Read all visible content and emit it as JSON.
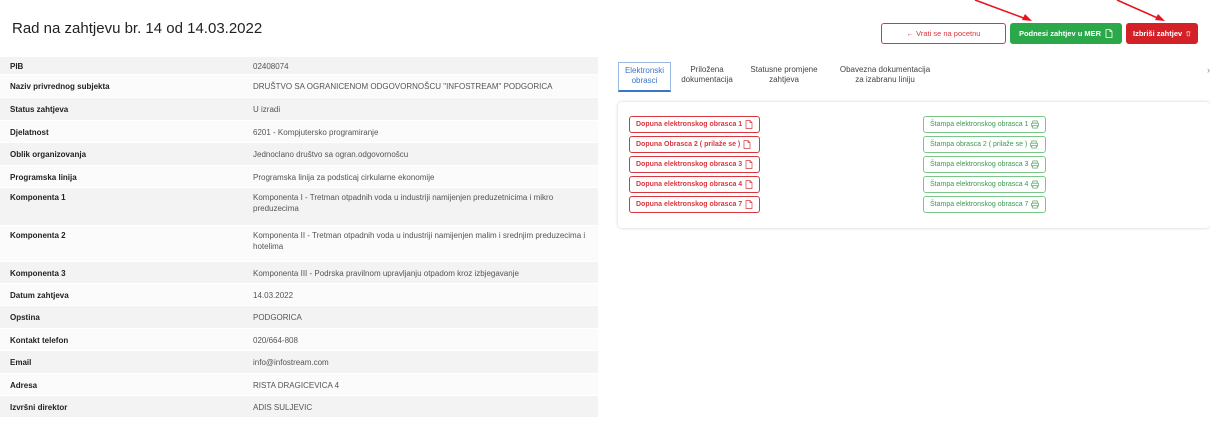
{
  "page_title": "Rad na zahtjevu br. 14 od 14.03.2022",
  "actions": {
    "back_label": "← Vrati se na pocetnu",
    "submit_label": "Podnesi zahtjev u MER",
    "delete_label": "Izbriši zahtjev"
  },
  "details": [
    {
      "label": "PIB",
      "value": "02408074"
    },
    {
      "label": "Naziv privrednog subjekta",
      "value": "DRUŠTVO SA OGRANICENOM ODGOVORNOŠCU \"INFOSTREAM\" PODGORICA"
    },
    {
      "label": "Status zahtjeva",
      "value": "U izradi"
    },
    {
      "label": "Djelatnost",
      "value": "6201 - Kompjutersko programiranje"
    },
    {
      "label": "Oblik organizovanja",
      "value": "Jednoclano društvo sa ogran.odgovornošcu"
    },
    {
      "label": "Programska linija",
      "value": "Programska linija za podsticaj cirkularne ekonomije"
    },
    {
      "label": "Komponenta 1",
      "value": "Komponenta I - Tretman otpadnih voda u industriji namijenjen preduzetnicima i mikro preduzecima"
    },
    {
      "label": "Komponenta 2",
      "value": "Komponenta II - Tretman otpadnih voda u industriji namijenjen malim i srednjim preduzecima i hotelima"
    },
    {
      "label": "Komponenta 3",
      "value": "Komponenta III - Podrska pravilnom upravljanju otpadom kroz izbjegavanje"
    },
    {
      "label": "Datum zahtjeva",
      "value": "14.03.2022"
    },
    {
      "label": "Opstina",
      "value": "PODGORICA"
    },
    {
      "label": "Kontakt telefon",
      "value": "020/664-808"
    },
    {
      "label": "Email",
      "value": "info@infostream.com"
    },
    {
      "label": "Adresa",
      "value": "RISTA DRAGICEVICA 4"
    },
    {
      "label": "Izvršni direktor",
      "value": "ADIS SULJEVIC"
    }
  ],
  "tabs": [
    {
      "line1": "Elektronski",
      "line2": "obrasci"
    },
    {
      "line1": "Priložena",
      "line2": "dokumentacija"
    },
    {
      "line1": "Statusne promjene",
      "line2": "zahtjeva"
    },
    {
      "line1": "Obavezna dokumentacija",
      "line2": "za izabranu liniju"
    }
  ],
  "tab_chevron": "›",
  "edit_buttons": [
    "Dopuna elektronskog obrasca 1",
    "Dopuna Obrasca 2 ( prilaže se )",
    "Dopuna elektronskog obrasca 3",
    "Dopuna elektronskog obrasca 4",
    "Dopuna elektronskog obrasca 7"
  ],
  "print_buttons": [
    "Štampa elektronskog obrasca 1",
    "Štampa obrasca 2 ( prilaže se )",
    "Štampa elektronskog obrasca 3",
    "Štampa elektronskog obrasca 4",
    "Štampa elektronskog obrasca 7"
  ],
  "colors": {
    "accent_blue": "#3a76c9",
    "danger": "#d42027",
    "success": "#2aa84a",
    "annotation_arrow": "#e8141c"
  },
  "icons": {
    "submit": "document-icon",
    "delete": "trash-icon",
    "edit": "document-icon",
    "print": "printer-icon"
  }
}
